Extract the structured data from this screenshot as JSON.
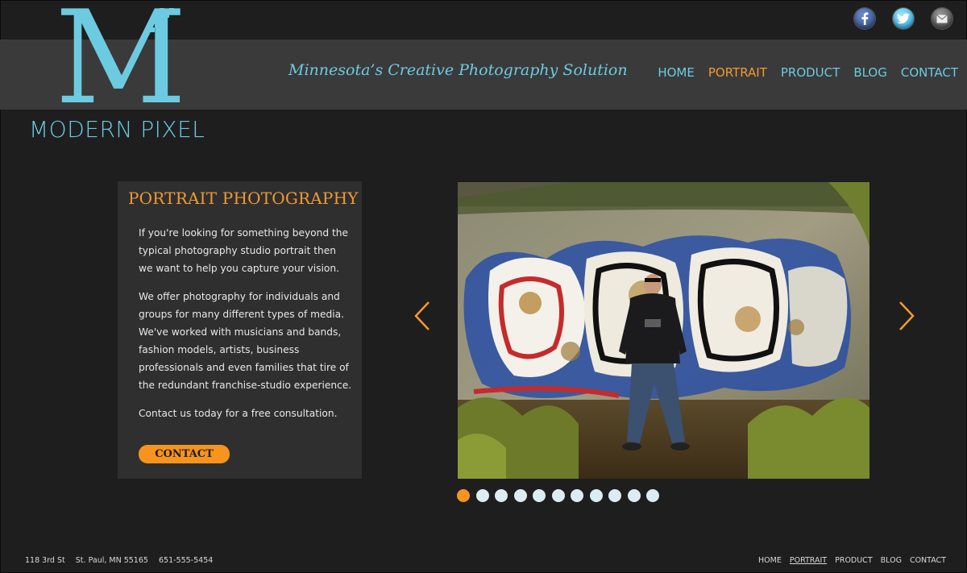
{
  "brand": {
    "logo_letter": "M",
    "name": "MODERN PIXEL",
    "tagline": "Minnesota’s Creative Photography Solution"
  },
  "social": [
    {
      "icon": "facebook-icon",
      "glyph": "f"
    },
    {
      "icon": "twitter-icon",
      "glyph": ""
    },
    {
      "icon": "email-icon",
      "glyph": ""
    }
  ],
  "nav": [
    {
      "label": "HOME",
      "active": false
    },
    {
      "label": "PORTRAIT",
      "active": true
    },
    {
      "label": "PRODUCT",
      "active": false
    },
    {
      "label": "BLOG",
      "active": false
    },
    {
      "label": "CONTACT",
      "active": false
    }
  ],
  "panel": {
    "heading": "PORTRAIT PHOTOGRAPHY",
    "paragraphs": [
      "If you're looking for something beyond the typical photography studio portrait then we want to help you capture your vision.",
      "We offer photography for individuals and groups for many different types of media. We've worked with musicians and bands, fashion models, artists, business professionals and even families that tire of the redundant franchise-studio experience.",
      "Contact us today for a free consultation."
    ],
    "button_label": "CONTACT"
  },
  "slider": {
    "slide_count": 11,
    "active_index": 0
  },
  "footer": {
    "street": "118 3rd St",
    "city": "St. Paul, MN 55165",
    "phone": "651-555-5454",
    "nav": [
      {
        "label": "HOME",
        "active": false
      },
      {
        "label": "PORTRAIT",
        "active": true
      },
      {
        "label": "PRODUCT",
        "active": false
      },
      {
        "label": "BLOG",
        "active": false
      },
      {
        "label": "CONTACT",
        "active": false
      }
    ]
  },
  "colors": {
    "accent": "#f29a2e",
    "brand_blue": "#6ccbe0",
    "background": "#1e1e1f",
    "band": "#3a3a3b"
  }
}
